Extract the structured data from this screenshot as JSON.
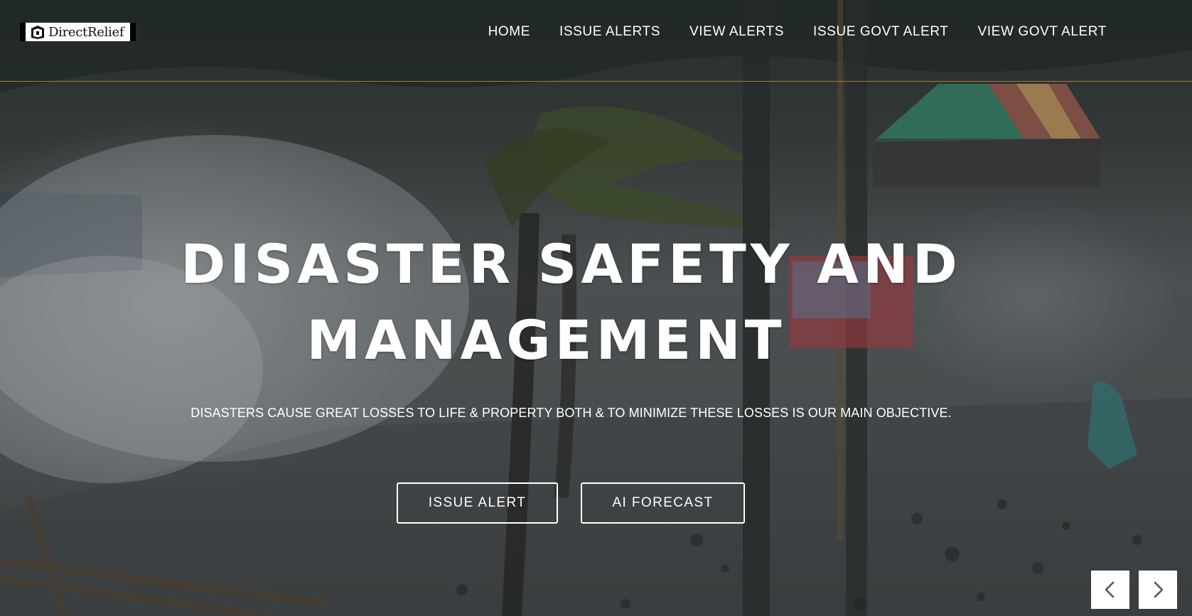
{
  "brand": {
    "logo_text": "DirectRelief"
  },
  "nav": {
    "items": [
      {
        "label": "HOME"
      },
      {
        "label": "ISSUE ALERTS"
      },
      {
        "label": "VIEW ALERTS"
      },
      {
        "label": "ISSUE GOVT ALERT"
      },
      {
        "label": "VIEW GOVT ALERT"
      }
    ]
  },
  "hero": {
    "headline_line_1": "DISASTER SAFETY AND",
    "headline_line_2": "MANAGEMENT",
    "subtitle": "DISASTERS CAUSE GREAT LOSSES TO LIFE & PROPERTY BOTH & TO MINIMIZE THESE LOSSES IS OUR MAIN OBJECTIVE.",
    "buttons": {
      "primary": "ISSUE ALERT",
      "secondary": "AI FORECAST"
    },
    "background_image": "storm-palm-trees-typhoon"
  },
  "carousel": {
    "prev_icon": "chevron-left-icon",
    "next_icon": "chevron-right-icon"
  },
  "colors": {
    "nav_divider": "#a87b34",
    "text": "#ffffff",
    "arrow_bg": "#ffffff",
    "arrow_icon": "#555555"
  }
}
